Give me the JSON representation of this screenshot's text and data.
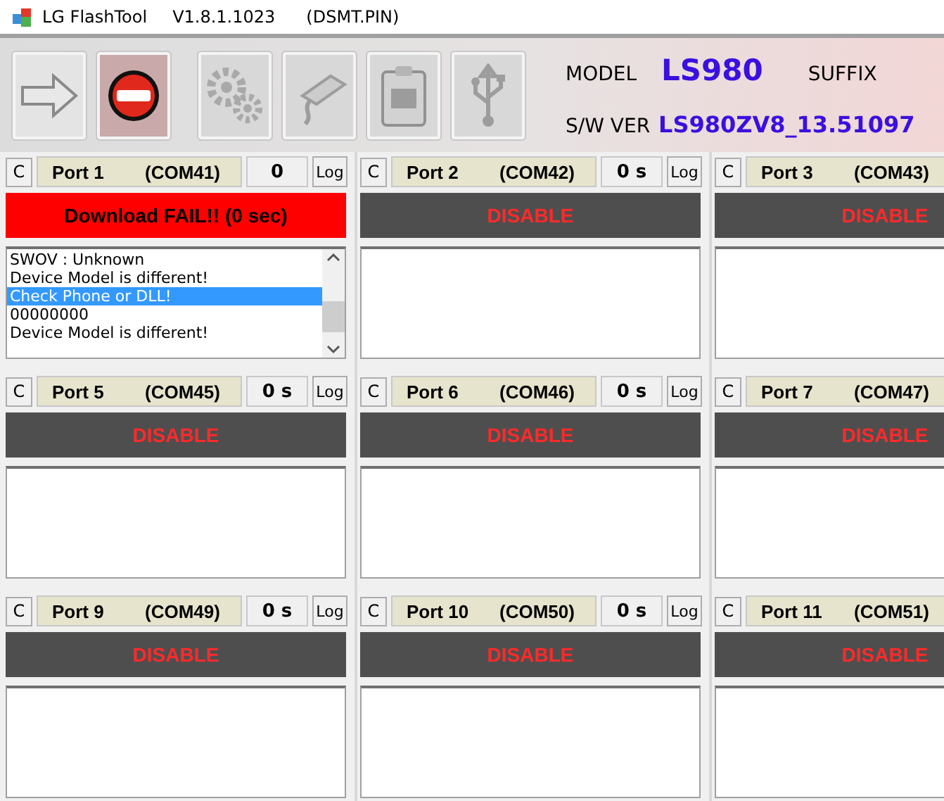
{
  "window": {
    "title": "LG FlashTool",
    "version": "V1.8.1.1023",
    "file": "(DSMT.PIN)"
  },
  "toolbar": [
    {
      "kind": "start",
      "disabled": false
    },
    {
      "kind": "stop",
      "disabled": false
    },
    {
      "kind": "settings",
      "disabled": true
    },
    {
      "kind": "serial",
      "disabled": true
    },
    {
      "kind": "clipboard",
      "disabled": true
    },
    {
      "kind": "usb",
      "disabled": true
    }
  ],
  "info": {
    "model_label": "MODEL",
    "model": "LS980",
    "suffix_label": "SUFFIX",
    "swver_label": "S/W VER",
    "swver": "LS980ZV8_13.51097"
  },
  "ports": [
    {
      "clear": "C",
      "name": "Port 1",
      "com": "(COM41)",
      "count": "0",
      "log": "Log",
      "status": {
        "kind": "fail",
        "text": "Download FAIL!!  (0 sec)"
      },
      "scrollbar": true,
      "lines": [
        {
          "text": "SWOV : Unknown",
          "selected": false
        },
        {
          "text": "Device Model is different!",
          "selected": false
        },
        {
          "text": "Check Phone or DLL!",
          "selected": true
        },
        {
          "text": "00000000",
          "selected": false
        },
        {
          "text": "Device Model is different!",
          "selected": false
        }
      ]
    },
    {
      "clear": "C",
      "name": "Port 2",
      "com": "(COM42)",
      "count": "0 s",
      "log": "Log",
      "status": {
        "kind": "disabled",
        "text": "DISABLE"
      }
    },
    {
      "clear": "C",
      "name": "Port 3",
      "com": "(COM43)",
      "status": {
        "kind": "disabled",
        "text": "DISABLE"
      }
    },
    {
      "clear": "C",
      "name": "Port 5",
      "com": "(COM45)",
      "count": "0 s",
      "log": "Log",
      "status": {
        "kind": "disabled",
        "text": "DISABLE"
      }
    },
    {
      "clear": "C",
      "name": "Port 6",
      "com": "(COM46)",
      "count": "0 s",
      "log": "Log",
      "status": {
        "kind": "disabled",
        "text": "DISABLE"
      }
    },
    {
      "clear": "C",
      "name": "Port 7",
      "com": "(COM47)",
      "status": {
        "kind": "disabled",
        "text": "DISABLE"
      }
    },
    {
      "clear": "C",
      "name": "Port 9",
      "com": "(COM49)",
      "count": "0 s",
      "log": "Log",
      "status": {
        "kind": "disabled",
        "text": "DISABLE"
      }
    },
    {
      "clear": "C",
      "name": "Port 10",
      "com": "(COM50)",
      "count": "0 s",
      "log": "Log",
      "status": {
        "kind": "disabled",
        "text": "DISABLE"
      }
    },
    {
      "clear": "C",
      "name": "Port 11",
      "com": "(COM51)",
      "status": {
        "kind": "disabled",
        "text": "DISABLE"
      }
    }
  ]
}
